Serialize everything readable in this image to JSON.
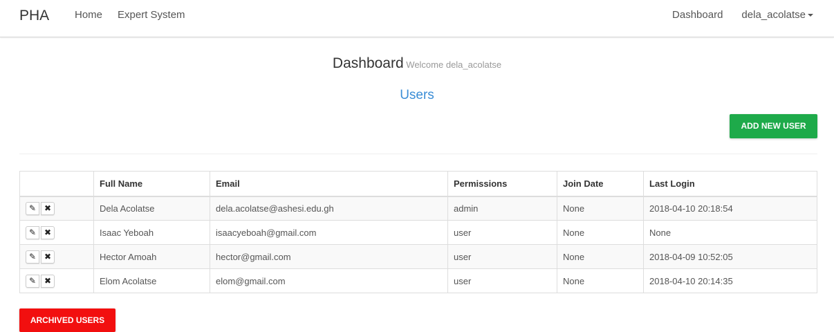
{
  "navbar": {
    "brand": "PHA",
    "left_links": [
      "Home",
      "Expert System"
    ],
    "right_links": {
      "dashboard": "Dashboard",
      "user": "dela_acolatse"
    }
  },
  "page": {
    "title": "Dashboard",
    "welcome": "Welcome dela_acolatse",
    "section_title": "Users",
    "add_button": "ADD NEW USER",
    "archived_button": "ARCHIVED USERS"
  },
  "table": {
    "headers": [
      "",
      "Full Name",
      "Email",
      "Permissions",
      "Join Date",
      "Last Login"
    ],
    "rows": [
      {
        "name": "Dela Acolatse",
        "email": "dela.acolatse@ashesi.edu.gh",
        "permissions": "admin",
        "join_date": "None",
        "last_login": "2018-04-10 20:18:54"
      },
      {
        "name": "Isaac Yeboah",
        "email": "isaacyeboah@gmail.com",
        "permissions": "user",
        "join_date": "None",
        "last_login": "None"
      },
      {
        "name": "Hector Amoah",
        "email": "hector@gmail.com",
        "permissions": "user",
        "join_date": "None",
        "last_login": "2018-04-09 10:52:05"
      },
      {
        "name": "Elom Acolatse",
        "email": "elom@gmail.com",
        "permissions": "user",
        "join_date": "None",
        "last_login": "2018-04-10 20:14:35"
      }
    ],
    "row_actions": {
      "edit_icon": "pencil-icon",
      "delete_icon": "close-icon"
    }
  },
  "colors": {
    "add_button": "#1eaa4a",
    "archived_button": "#f20f0f",
    "section_title": "#3a8dd6"
  }
}
